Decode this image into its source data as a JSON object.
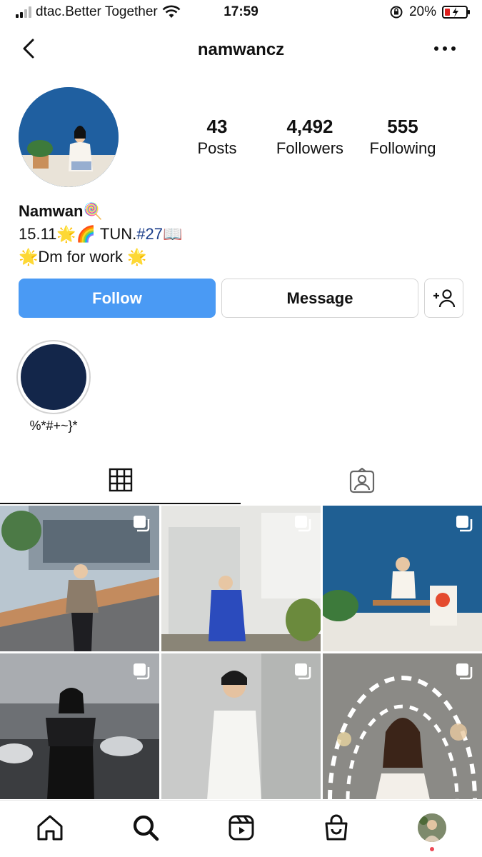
{
  "status_bar": {
    "carrier": "dtac.Better Together",
    "time": "17:59",
    "battery": "20%"
  },
  "nav": {
    "username": "namwancz",
    "back_icon": "chevron-left-icon",
    "more_icon": "more-horizontal-icon"
  },
  "profile": {
    "posts_count": "43",
    "posts_label": "Posts",
    "followers_count": "4,492",
    "followers_label": "Followers",
    "following_count": "555",
    "following_label": "Following",
    "display_name": "Namwan🍭",
    "bio_line1_prefix": "15.11🌟🌈 TUN.",
    "bio_line1_tag": "#27📖",
    "bio_line2": "🌟Dm for work 🌟"
  },
  "actions": {
    "follow_label": "Follow",
    "message_label": "Message",
    "add_user_icon": "add-user-icon"
  },
  "highlights": [
    {
      "label": "%*#+~}*"
    }
  ],
  "tabs": [
    {
      "name": "grid",
      "icon": "grid-icon",
      "active": true
    },
    {
      "name": "tagged",
      "icon": "tagged-person-icon",
      "active": false
    }
  ],
  "posts": [
    {
      "multiple": true
    },
    {
      "multiple": true
    },
    {
      "multiple": true
    },
    {
      "multiple": true
    },
    {
      "multiple": true
    },
    {
      "multiple": true
    }
  ],
  "bottom_nav": [
    {
      "icon": "home-icon"
    },
    {
      "icon": "search-icon",
      "active": true
    },
    {
      "icon": "reels-icon"
    },
    {
      "icon": "shop-icon"
    },
    {
      "icon": "profile-avatar"
    }
  ],
  "colors": {
    "follow_button": "#4a9af4",
    "hashtag": "#1b3e8a",
    "highlight_fill": "#13264a",
    "notification_dot": "#ed4956"
  }
}
